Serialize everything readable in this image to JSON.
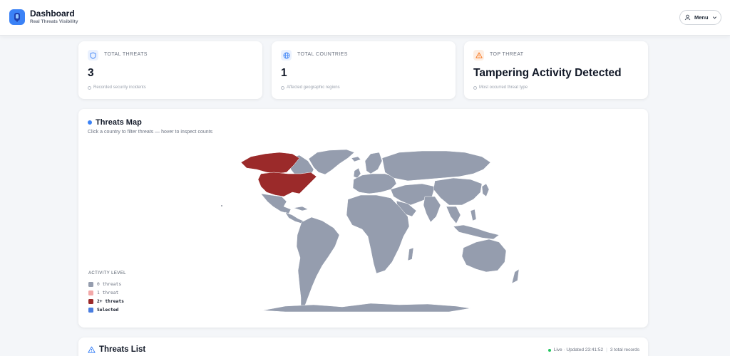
{
  "header": {
    "app_title": "Dashboard",
    "app_subtitle": "Real Threats Visibility",
    "menu_label": "Menu"
  },
  "stats": [
    {
      "label": "TOTAL THREATS",
      "value": "3",
      "note": "Recorded security incidents",
      "icon": "shield-icon"
    },
    {
      "label": "TOTAL COUNTRIES",
      "value": "1",
      "note": "Affected geographic regions",
      "icon": "globe-icon"
    },
    {
      "label": "TOP THREAT",
      "value": "Tampering Activity Detected",
      "note": "Most occurred threat type",
      "icon": "warning-icon"
    }
  ],
  "map": {
    "title": "Threats Map",
    "subtitle": "Click a country to filter threats — hover to inspect counts",
    "legend_title": "ACTIVITY LEVEL",
    "legend": [
      {
        "label": "0 threats",
        "color": "#959dae"
      },
      {
        "label": "1 threat",
        "color": "#f2a8a8"
      },
      {
        "label": "2+ threats",
        "color": "#9b2a2a"
      },
      {
        "label": "Selected",
        "color": "#4a7ee0"
      }
    ]
  },
  "threats_list": {
    "title": "Threats List",
    "live_text": "Live · Updated 23:41:52",
    "records_text": "3 total records"
  },
  "colors": {
    "accent": "#3b82f6",
    "country_default": "#959dae",
    "country_hot": "#9b2a2a",
    "live": "#22c55e"
  }
}
